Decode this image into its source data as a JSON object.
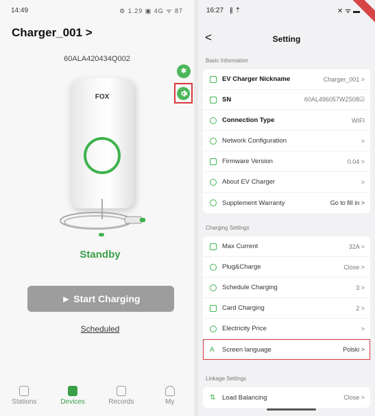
{
  "left": {
    "status_bar": {
      "time": "14:49",
      "icons": "⚙ 1.29 ▣ 4G ᯤ 87"
    },
    "device_title": "Charger_001 >",
    "serial": "60ALA420434Q002",
    "brand": "FOX",
    "status": "Standby",
    "start_button": "► Start Charging",
    "scheduled": "Scheduled",
    "nav": [
      {
        "label": "Stations"
      },
      {
        "label": "Devices"
      },
      {
        "label": "Records"
      },
      {
        "label": "My"
      }
    ],
    "colors": {
      "accent": "#3fb24e",
      "highlight": "#d9373b"
    }
  },
  "right": {
    "status_bar": {
      "time": "16:27",
      "icons_left": "∦ ⇡",
      "icons_right": "✕ ᯤ ▬"
    },
    "title": "Setting",
    "basic": {
      "label": "Basic Information",
      "rows": [
        {
          "label": "EV Charger Nickname",
          "value": "Charger_001 >"
        },
        {
          "label": "SN",
          "value": "60AL496057WZ508☑"
        },
        {
          "label": "Connection Type",
          "value": "WIFI"
        },
        {
          "label": "Network Configuration",
          "value": ">"
        },
        {
          "label": "Firmware Version",
          "value": "0.04 >"
        },
        {
          "label": "About EV Charger",
          "value": ">"
        },
        {
          "label": "Supplement Warranty",
          "value": "Go to fill in >"
        }
      ]
    },
    "charging": {
      "label": "Charging Settings",
      "rows": [
        {
          "label": "Max Current",
          "value": "32A >"
        },
        {
          "label": "Plug&Charge",
          "value": "Close >"
        },
        {
          "label": "Schedule Charging",
          "value": "3 >"
        },
        {
          "label": "Card Charging",
          "value": "2 >"
        },
        {
          "label": "Electricity Price",
          "value": ">"
        },
        {
          "label": "Screen language",
          "value": "Polski >"
        }
      ]
    },
    "linkage": {
      "label": "Linkage Settings",
      "rows": [
        {
          "label": "Load Balancing",
          "value": "Close >"
        }
      ]
    }
  }
}
